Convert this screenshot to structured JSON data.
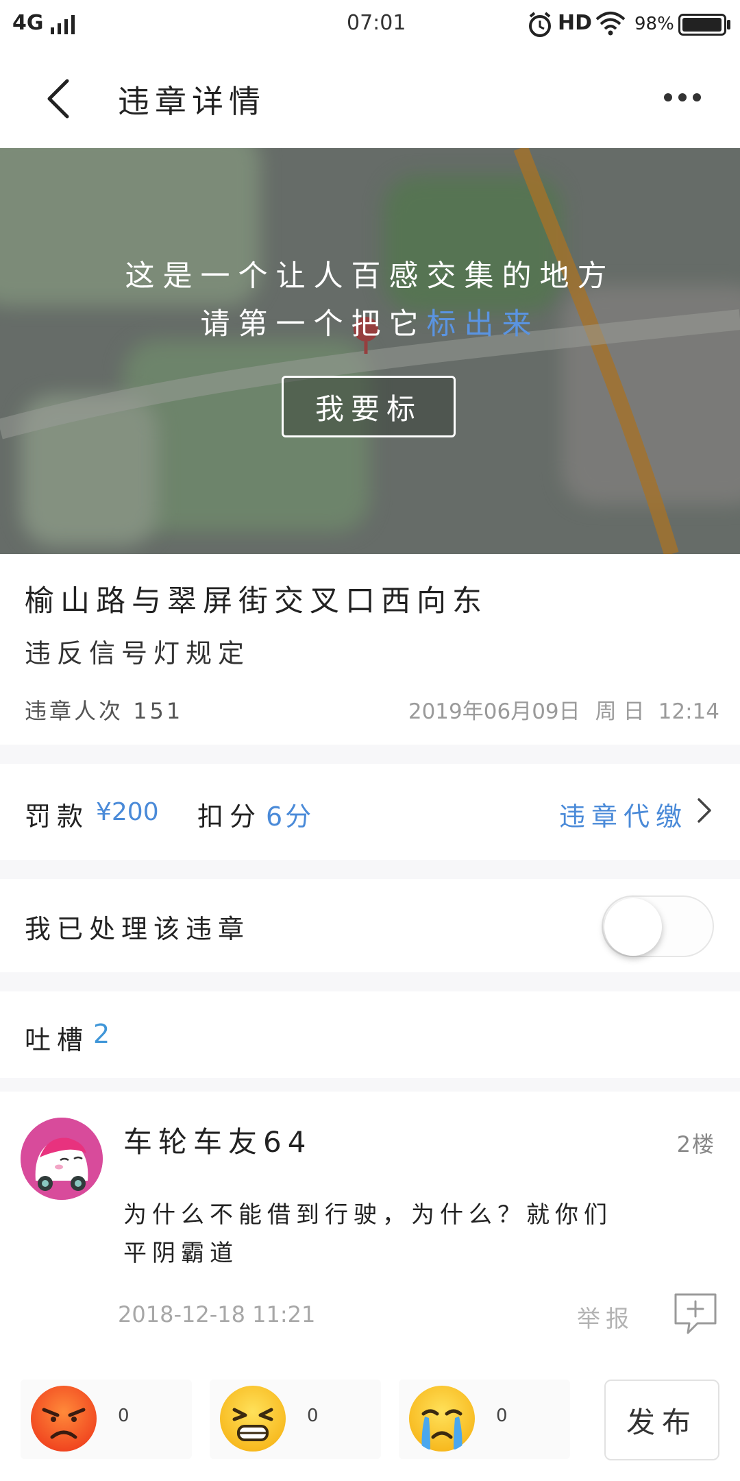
{
  "status_bar": {
    "network": "4G",
    "time": "07:01",
    "hd": "HD",
    "battery": "98%",
    "battery_level": 0.98
  },
  "header": {
    "title": "违章详情"
  },
  "map_banner": {
    "line1": "这是一个让人百感交集的地方",
    "line2_prefix": "请第一个把它",
    "line2_link": "标出来",
    "button": "我要标"
  },
  "violation": {
    "location": "榆山路与翠屏街交叉口西向东",
    "type": "违反信号灯规定",
    "count_label": "违章人次",
    "count": "151",
    "date": "2019年06月09日",
    "weekday": "周日",
    "time": "12:14"
  },
  "penalty": {
    "fine_label": "罚款",
    "fine_value": "¥200",
    "points_label": "扣分",
    "points_value": "6分",
    "pay_link": "违章代缴"
  },
  "handled": {
    "label": "我已处理该违章",
    "on": false
  },
  "comments_section": {
    "label": "吐槽",
    "count": "2"
  },
  "comment": {
    "username": "车轮车友64",
    "floor": "2楼",
    "text_line1": "为什么不能借到行驶，为什么？就你们",
    "text_line2": "平阴霸道",
    "date": "2018-12-18 11:21",
    "report": "举报"
  },
  "reactions": [
    {
      "icon": "angry-face-icon",
      "count": "0"
    },
    {
      "icon": "grimace-face-icon",
      "count": "0"
    },
    {
      "icon": "crying-face-icon",
      "count": "0"
    }
  ],
  "publish_label": "发布",
  "colors": {
    "accent": "#4a8ad8",
    "link_on_map": "#5a94e2",
    "comment_count": "#3f96d8",
    "section_gap": "#f7f7f9"
  }
}
